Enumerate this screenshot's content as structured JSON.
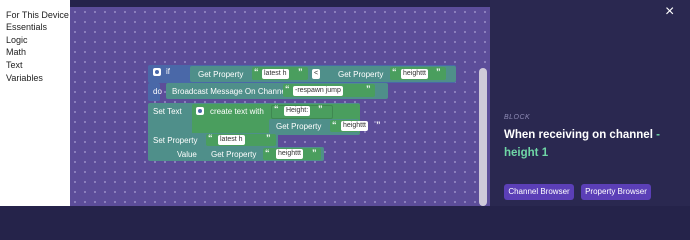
{
  "toolbox": {
    "categories": [
      "For This Device",
      "Essentials",
      "Logic",
      "Math",
      "Text",
      "Variables"
    ]
  },
  "blocks": {
    "if_label": "if",
    "get_property": "Get Property",
    "latest_h": "latest h",
    "less_than": "<",
    "heighttt": "heighttt",
    "do_label": "do",
    "broadcast": "Broadcast Message On Channel",
    "respawn_jump": "-respawn jump",
    "set_text": "Set Text",
    "create_text_with": "create text with",
    "height_colon": "Height:",
    "set_property": "Set Property",
    "value_label": "Value"
  },
  "panel": {
    "block_label": "BLOCK",
    "title_prefix": "When receiving on channel",
    "title_dash": "-",
    "title_value": "height 1",
    "channel_browser": "Channel Browser",
    "property_browser": "Property Browser",
    "close_icon": "×"
  },
  "colors": {
    "workspace": "#5c4d99",
    "logic_block": "#4a68a8",
    "action_block": "#4f8f8a",
    "text_block": "#4a9e5e",
    "accent": "#6fd6a6",
    "button": "#5b3fb7"
  }
}
